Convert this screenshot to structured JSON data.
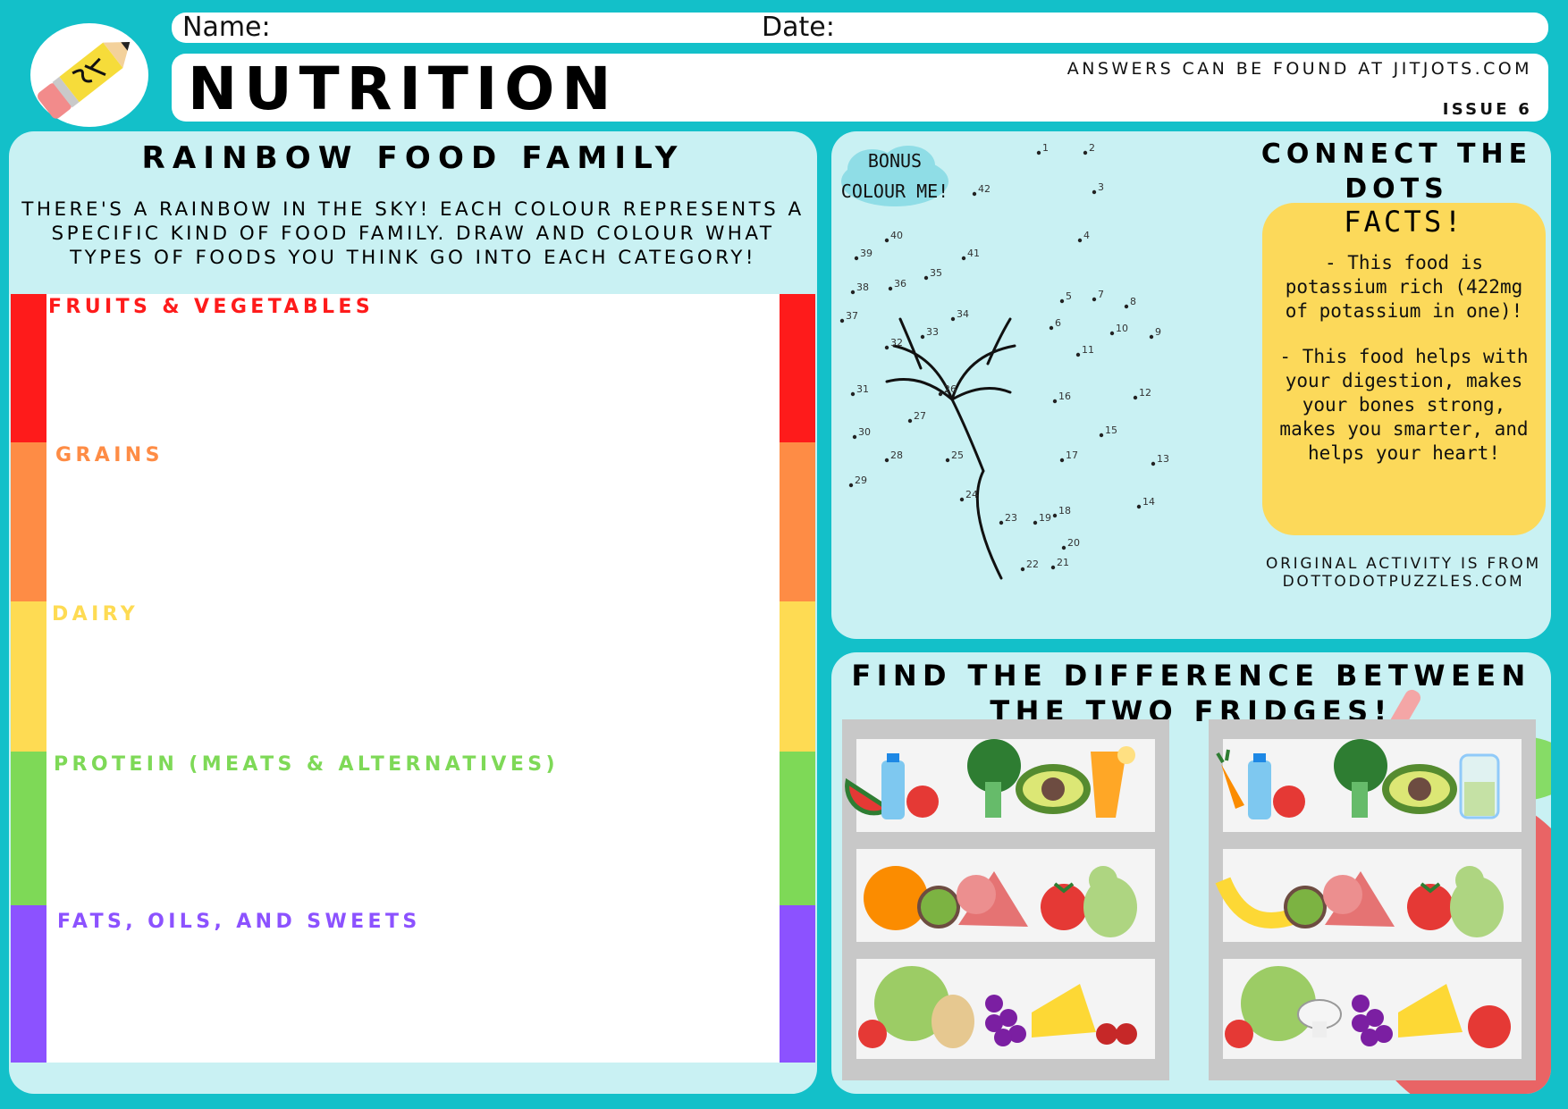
{
  "header": {
    "name_label": "Name:",
    "date_label": "Date:",
    "title": "NUTRITION",
    "answers_note": "ANSWERS CAN BE FOUND AT JITJOTS.COM",
    "issue": "ISSUE 6"
  },
  "rainbow": {
    "title": "RAINBOW FOOD FAMILY",
    "description": "THERE'S A RAINBOW IN THE SKY! EACH COLOUR REPRESENTS A SPECIFIC KIND OF FOOD FAMILY. DRAW AND COLOUR WHAT TYPES OF FOODS YOU THINK GO INTO EACH CATEGORY!",
    "categories": [
      {
        "label": "FRUITS & VEGETABLES",
        "color": "#fe1b1b"
      },
      {
        "label": "GRAINS",
        "color": "#fe8c45"
      },
      {
        "label": "DAIRY",
        "color": "#fedb53"
      },
      {
        "label": "PROTEIN (MEATS & ALTERNATIVES)",
        "color": "#7ed957"
      },
      {
        "label": "FATS, OILS, AND SWEETS",
        "color": "#8c52ff"
      }
    ]
  },
  "dots": {
    "title": "CONNECT THE DOTS",
    "bonus": "BONUS COLOUR ME!",
    "facts_title": "FACTS!",
    "fact_1": "- This food is potassium rich (422mg of potassium in one)!",
    "fact_2": "- This food helps with your digestion, makes your bones strong, makes you smarter, and helps your heart!",
    "credit": "ORIGINAL ACTIVITY IS FROM DOTTODOTPUZZLES.COM",
    "numbers": [
      "1",
      "2",
      "3",
      "4",
      "5",
      "6",
      "7",
      "8",
      "9",
      "10",
      "11",
      "12",
      "13",
      "14",
      "15",
      "16",
      "17",
      "18",
      "19",
      "20",
      "21",
      "22",
      "23",
      "24",
      "25",
      "26",
      "27",
      "28",
      "29",
      "30",
      "31",
      "32",
      "33",
      "34",
      "35",
      "36",
      "37",
      "38",
      "39",
      "40",
      "41",
      "42"
    ]
  },
  "fridges": {
    "title": "FIND THE DIFFERENCE BETWEEN THE TWO FRIDGES!",
    "left_items": [
      "watermelon-icon",
      "water-bottle-icon",
      "strawberry-icon",
      "broccoli-icon",
      "avocado-icon",
      "juice-glass-icon",
      "orange-icon",
      "kiwi-icon",
      "ham-icon",
      "tomato-icon",
      "pear-icon",
      "lettuce-icon",
      "onion-icon",
      "grapes-icon",
      "cheese-icon",
      "cherries-icon",
      "strawberry-icon"
    ],
    "right_items": [
      "carrot-icon",
      "water-bottle-icon",
      "strawberry-icon",
      "broccoli-icon",
      "avocado-icon",
      "smoothie-jar-icon",
      "banana-icon",
      "kiwi-icon",
      "ham-icon",
      "tomato-icon",
      "pear-icon",
      "lettuce-icon",
      "mushroom-icon",
      "grapes-icon",
      "cheese-icon",
      "tomato-icon",
      "strawberry-icon"
    ]
  }
}
